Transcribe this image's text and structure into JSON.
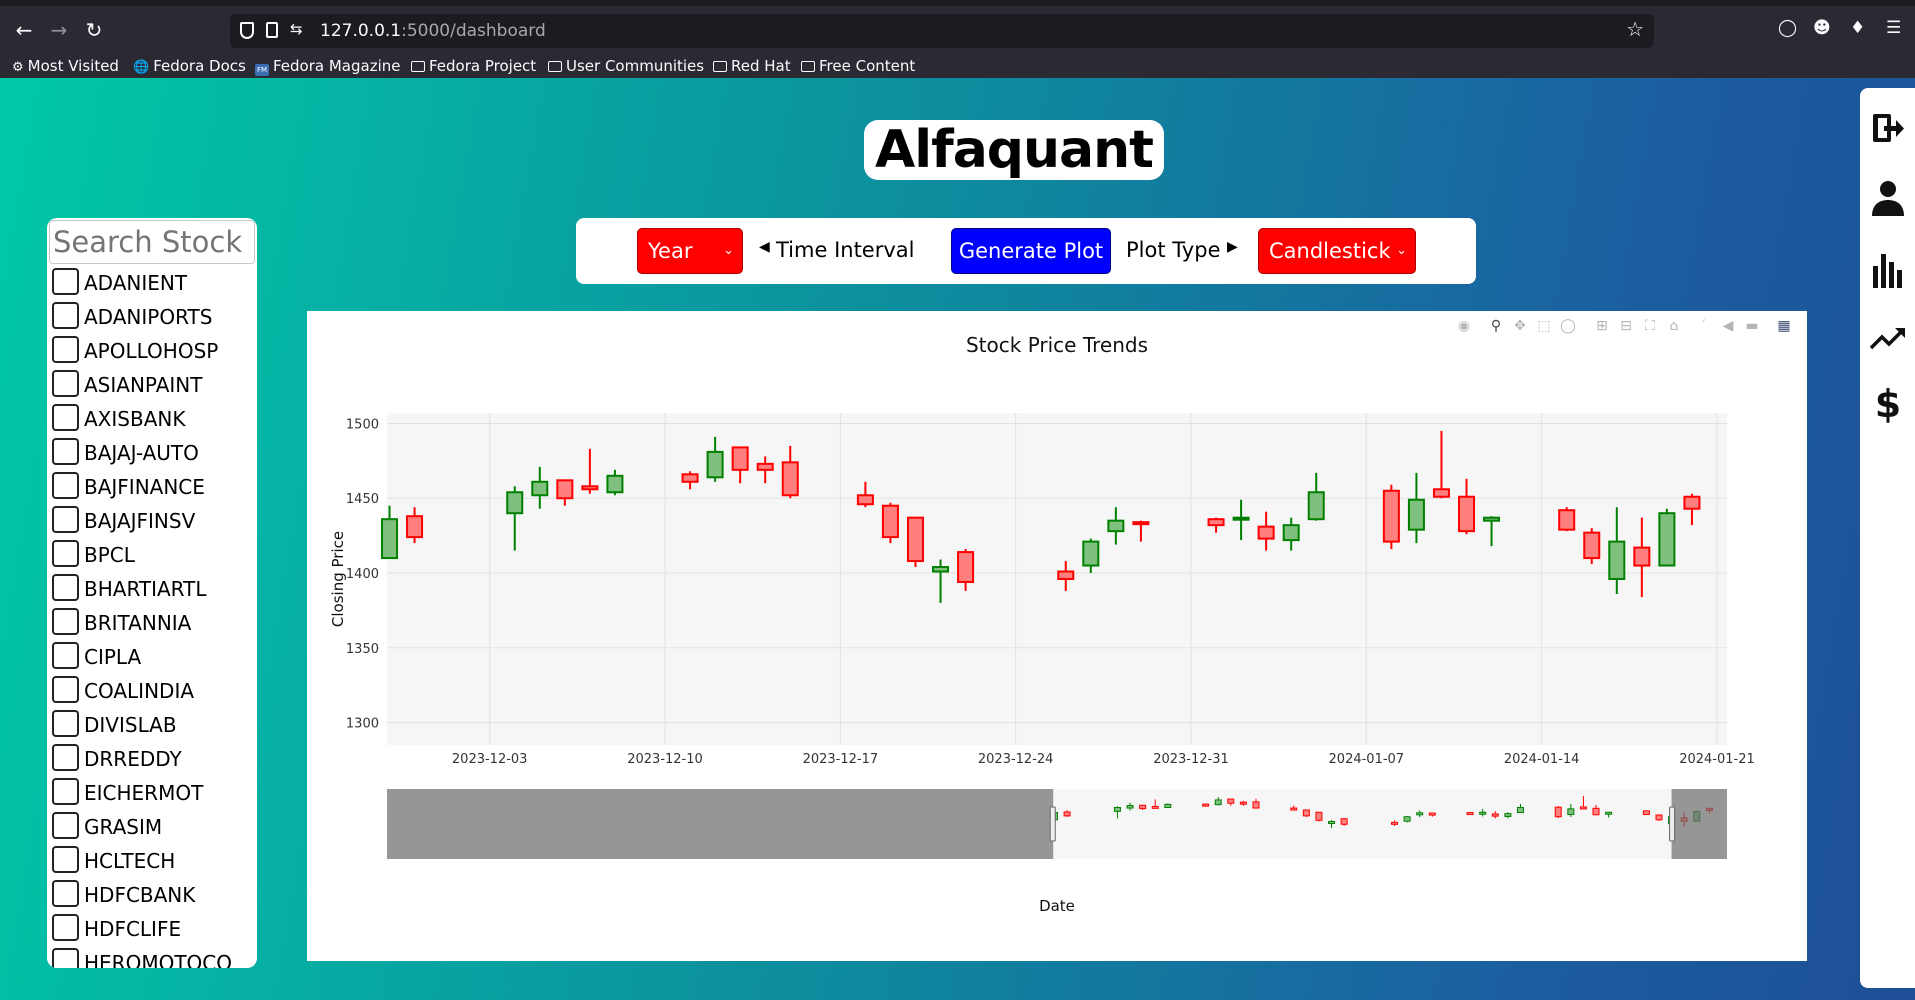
{
  "browser": {
    "url_host": "127.0.0.1",
    "url_path": ":5000/dashboard",
    "bookmarks": [
      {
        "label": "Most Visited",
        "icon": "gear-icon"
      },
      {
        "label": "Fedora Docs",
        "icon": "globe-icon"
      },
      {
        "label": "Fedora Magazine",
        "icon": "fedora-magazine-icon"
      },
      {
        "label": "Fedora Project",
        "icon": "folder-icon"
      },
      {
        "label": "User Communities",
        "icon": "folder-icon"
      },
      {
        "label": "Red Hat",
        "icon": "folder-icon"
      },
      {
        "label": "Free Content",
        "icon": "folder-icon"
      }
    ]
  },
  "app": {
    "title": "Alfaquant"
  },
  "sidebar": {
    "search_placeholder": "Search Stock",
    "stocks": [
      "ADANIENT",
      "ADANIPORTS",
      "APOLLOHOSP",
      "ASIANPAINT",
      "AXISBANK",
      "BAJAJ-AUTO",
      "BAJFINANCE",
      "BAJAJFINSV",
      "BPCL",
      "BHARTIARTL",
      "BRITANNIA",
      "CIPLA",
      "COALINDIA",
      "DIVISLAB",
      "DRREDDY",
      "EICHERMOT",
      "GRASIM",
      "HCLTECH",
      "HDFCBANK",
      "HDFCLIFE",
      "HEROMOTOCO"
    ]
  },
  "controls": {
    "interval_value": "Year",
    "interval_label": "Time Interval",
    "generate_label": "Generate Plot",
    "plot_type_label": "Plot Type",
    "plot_type_value": "Candlestick"
  },
  "colors": {
    "increasing": "#008000",
    "decreasing": "#ff0000",
    "primary_button": "#0000ff",
    "select": "#ff0000"
  },
  "chart_data": {
    "type": "candlestick",
    "title": "Stock Price Trends",
    "xlabel": "Date",
    "ylabel": "Closing Price",
    "ylim": [
      1285,
      1507
    ],
    "y_ticks": [
      1300,
      1350,
      1400,
      1450,
      1500
    ],
    "x_tick_labels": [
      "2023-12-03",
      "2023-12-10",
      "2023-12-17",
      "2023-12-24",
      "2023-12-31",
      "2024-01-07",
      "2024-01-14",
      "2024-01-21"
    ],
    "grid": true,
    "rangeslider": true,
    "candles": [
      {
        "date": "2023-11-29",
        "open": 1410,
        "high": 1445,
        "low": 1410,
        "close": 1436
      },
      {
        "date": "2023-11-30",
        "open": 1438,
        "high": 1444,
        "low": 1420,
        "close": 1424
      },
      {
        "date": "2023-12-04",
        "open": 1440,
        "high": 1458,
        "low": 1415,
        "close": 1454
      },
      {
        "date": "2023-12-05",
        "open": 1452,
        "high": 1471,
        "low": 1443,
        "close": 1461
      },
      {
        "date": "2023-12-06",
        "open": 1462,
        "high": 1462,
        "low": 1445,
        "close": 1450
      },
      {
        "date": "2023-12-07",
        "open": 1458,
        "high": 1483,
        "low": 1453,
        "close": 1456
      },
      {
        "date": "2023-12-08",
        "open": 1454,
        "high": 1469,
        "low": 1452,
        "close": 1465
      },
      {
        "date": "2023-12-11",
        "open": 1466,
        "high": 1468,
        "low": 1456,
        "close": 1461
      },
      {
        "date": "2023-12-12",
        "open": 1464,
        "high": 1491,
        "low": 1461,
        "close": 1481
      },
      {
        "date": "2023-12-13",
        "open": 1484,
        "high": 1484,
        "low": 1460,
        "close": 1469
      },
      {
        "date": "2023-12-14",
        "open": 1473,
        "high": 1478,
        "low": 1460,
        "close": 1469
      },
      {
        "date": "2023-12-15",
        "open": 1474,
        "high": 1485,
        "low": 1450,
        "close": 1452
      },
      {
        "date": "2023-12-18",
        "open": 1452,
        "high": 1461,
        "low": 1444,
        "close": 1446
      },
      {
        "date": "2023-12-19",
        "open": 1445,
        "high": 1447,
        "low": 1420,
        "close": 1424
      },
      {
        "date": "2023-12-20",
        "open": 1437,
        "high": 1437,
        "low": 1404,
        "close": 1408
      },
      {
        "date": "2023-12-21",
        "open": 1401,
        "high": 1409,
        "low": 1380,
        "close": 1404
      },
      {
        "date": "2023-12-22",
        "open": 1414,
        "high": 1416,
        "low": 1388,
        "close": 1394
      },
      {
        "date": "2023-12-26",
        "open": 1401,
        "high": 1408,
        "low": 1388,
        "close": 1396
      },
      {
        "date": "2023-12-27",
        "open": 1405,
        "high": 1423,
        "low": 1400,
        "close": 1421
      },
      {
        "date": "2023-12-28",
        "open": 1428,
        "high": 1444,
        "low": 1419,
        "close": 1435
      },
      {
        "date": "2023-12-29",
        "open": 1434,
        "high": 1435,
        "low": 1421,
        "close": 1433
      },
      {
        "date": "2024-01-01",
        "open": 1436,
        "high": 1437,
        "low": 1427,
        "close": 1432
      },
      {
        "date": "2024-01-02",
        "open": 1437,
        "high": 1449,
        "low": 1422,
        "close": 1437
      },
      {
        "date": "2024-01-03",
        "open": 1431,
        "high": 1441,
        "low": 1415,
        "close": 1423
      },
      {
        "date": "2024-01-04",
        "open": 1422,
        "high": 1437,
        "low": 1415,
        "close": 1432
      },
      {
        "date": "2024-01-05",
        "open": 1436,
        "high": 1467,
        "low": 1435,
        "close": 1454
      },
      {
        "date": "2024-01-08",
        "open": 1455,
        "high": 1459,
        "low": 1416,
        "close": 1421
      },
      {
        "date": "2024-01-09",
        "open": 1429,
        "high": 1467,
        "low": 1420,
        "close": 1449
      },
      {
        "date": "2024-01-10",
        "open": 1456,
        "high": 1495,
        "low": 1450,
        "close": 1451
      },
      {
        "date": "2024-01-11",
        "open": 1451,
        "high": 1463,
        "low": 1426,
        "close": 1428
      },
      {
        "date": "2024-01-12",
        "open": 1435,
        "high": 1438,
        "low": 1418,
        "close": 1437
      },
      {
        "date": "2024-01-15",
        "open": 1442,
        "high": 1444,
        "low": 1428,
        "close": 1429
      },
      {
        "date": "2024-01-16",
        "open": 1427,
        "high": 1430,
        "low": 1406,
        "close": 1410
      },
      {
        "date": "2024-01-17",
        "open": 1396,
        "high": 1444,
        "low": 1386,
        "close": 1421
      },
      {
        "date": "2024-01-18",
        "open": 1417,
        "high": 1437,
        "low": 1384,
        "close": 1405
      },
      {
        "date": "2024-01-19",
        "open": 1405,
        "high": 1443,
        "low": 1405,
        "close": 1440
      },
      {
        "date": "2024-01-20",
        "open": 1451,
        "high": 1453,
        "low": 1432,
        "close": 1443
      }
    ]
  },
  "right_bar": {
    "icons": [
      "logout-icon",
      "user-icon",
      "bar-chart-icon",
      "trend-up-icon",
      "dollar-icon"
    ],
    "dollar_glyph": "$"
  },
  "modebar_icons": [
    "camera-icon",
    "zoom-icon",
    "pan-icon",
    "box-select-icon",
    "lasso-icon",
    "zoom-in-icon",
    "zoom-out-icon",
    "autoscale-icon",
    "reset-axes-icon",
    "spike-lines-icon",
    "hover-closest-icon",
    "hover-compare-icon",
    "plotly-logo-icon"
  ]
}
